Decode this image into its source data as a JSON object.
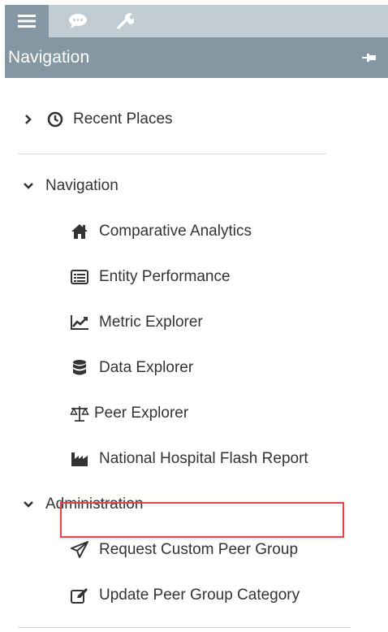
{
  "tabs": [
    {
      "icon": "hamburger-menu-icon",
      "active": true
    },
    {
      "icon": "chat-bubble-icon",
      "active": false
    },
    {
      "icon": "wrench-icon",
      "active": false
    }
  ],
  "header": {
    "title": "Navigation",
    "pin_icon": "pin-icon"
  },
  "recent": {
    "label": "Recent Places",
    "expanded": false,
    "icon": "clock-icon"
  },
  "sections": [
    {
      "label": "Navigation",
      "expanded": true,
      "items": [
        {
          "label": "Comparative Analytics",
          "icon": "home-icon"
        },
        {
          "label": "Entity Performance",
          "icon": "list-card-icon"
        },
        {
          "label": "Metric Explorer",
          "icon": "line-chart-icon"
        },
        {
          "label": "Data Explorer",
          "icon": "database-icon"
        },
        {
          "label": "Peer Explorer",
          "icon": "balance-scale-icon"
        },
        {
          "label": "National Hospital Flash Report",
          "icon": "factory-icon"
        }
      ]
    },
    {
      "label": "Administration",
      "expanded": true,
      "items": [
        {
          "label": "Request Custom Peer Group",
          "icon": "paper-plane-icon"
        },
        {
          "label": "Update Peer Group Category",
          "icon": "edit-icon",
          "highlighted": true
        }
      ]
    }
  ],
  "colors": {
    "accent": "#8497a2",
    "tabbar": "#c2cdd3",
    "highlight": "#e2454b",
    "text": "#333333"
  }
}
